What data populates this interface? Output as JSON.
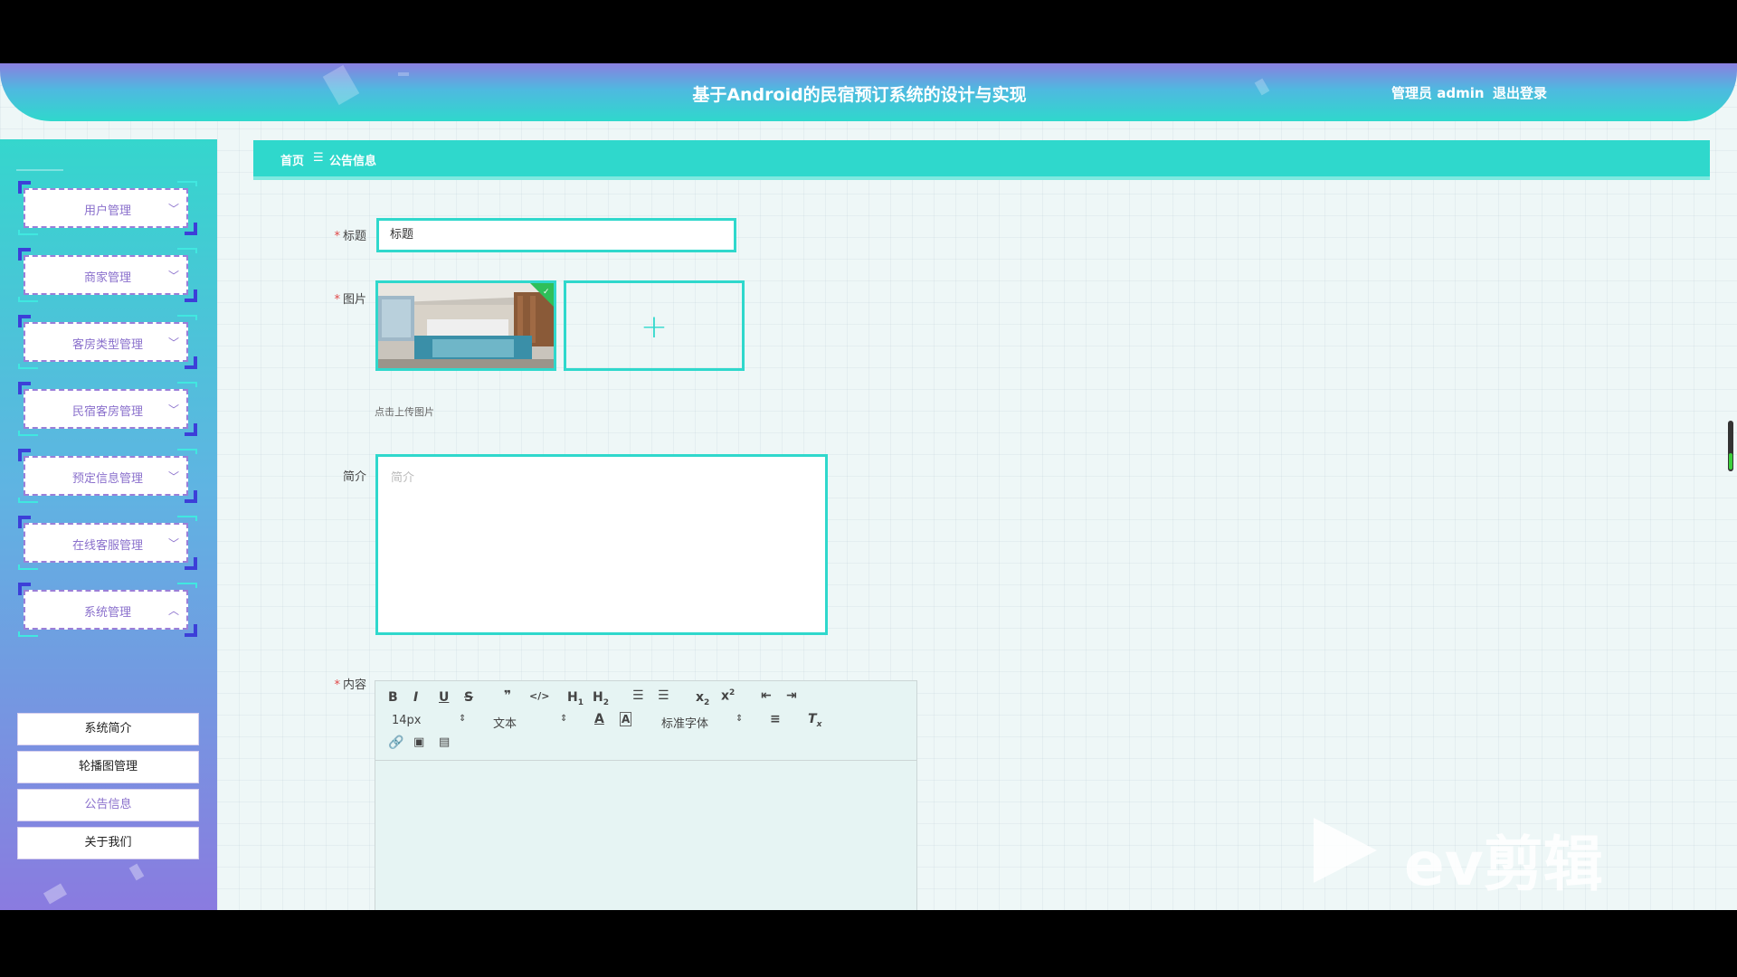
{
  "header": {
    "title": "基于Android的民宿预订系统的设计与实现",
    "user": "管理员 admin",
    "logout": "退出登录"
  },
  "sidebar": {
    "menus": [
      {
        "label": "用户管理",
        "chevron": "chevron-down-icon"
      },
      {
        "label": "商家管理",
        "chevron": "chevron-down-icon"
      },
      {
        "label": "客房类型管理",
        "chevron": "chevron-down-icon"
      },
      {
        "label": "民宿客房管理",
        "chevron": "chevron-down-icon"
      },
      {
        "label": "预定信息管理",
        "chevron": "chevron-down-icon"
      },
      {
        "label": "在线客服管理",
        "chevron": "chevron-down-icon"
      },
      {
        "label": "系统管理",
        "chevron": "chevron-up-icon"
      }
    ],
    "sub_items": [
      {
        "label": "系统简介"
      },
      {
        "label": "轮播图管理"
      },
      {
        "label": "公告信息",
        "active": true
      },
      {
        "label": "关于我们"
      }
    ]
  },
  "breadcrumb": {
    "home": "首页",
    "separator": "☰",
    "current": "公告信息"
  },
  "form": {
    "title_label": "标题",
    "title_value": "标题",
    "image_label": "图片",
    "upload_tip": "点击上传图片",
    "intro_label": "简介",
    "intro_placeholder": "简介",
    "content_label": "内容"
  },
  "editor": {
    "font_size": "14px",
    "text_style": "文本",
    "font_family": "标准字体"
  },
  "watermark": {
    "text": "ev剪辑"
  },
  "colors": {
    "accent": "#2fd8cc",
    "menu_text": "#8a70cc",
    "required": "#e04848"
  }
}
